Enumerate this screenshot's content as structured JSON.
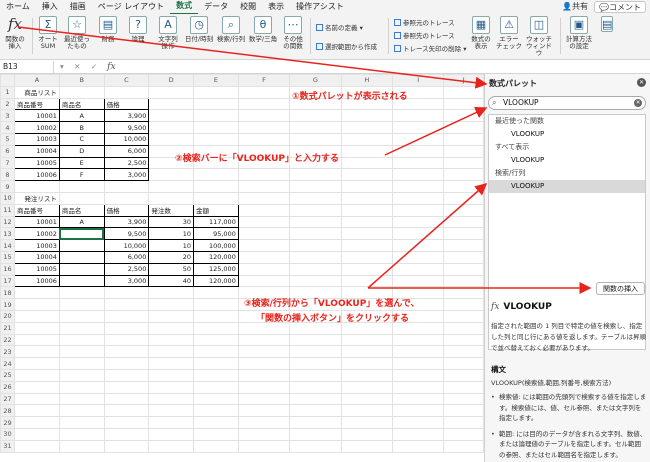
{
  "ribbon_tabs": [
    "ホーム",
    "挿入",
    "描画",
    "ページ レイアウト",
    "数式",
    "データ",
    "校閲",
    "表示",
    "操作アシスト"
  ],
  "active_tab": "数式",
  "share_label": "共有",
  "comment_label": "コメント",
  "ribbon": {
    "insert_function": "関数の\n挿入",
    "autosum": "オート\nSUM",
    "recent": "最近使っ\nたもの",
    "financial": "財務",
    "logical": "論理",
    "text": "文字列\n操作",
    "datetime": "日付/時刻",
    "lookup": "検索/行列",
    "math": "数学/三角",
    "more": "その他\nの関数",
    "define_name": "名前の定義",
    "create_from_selection": "選択範囲から作成",
    "trace_precedents": "参照元のトレース",
    "trace_dependents": "参照先のトレース",
    "remove_arrows": "トレース矢印の削除",
    "show_formulas": "数式の\n表示",
    "error_check": "エラー\nチェック",
    "watch_window": "ウォッチ\nウィンドウ",
    "calc_options": "計算方法\nの設定"
  },
  "formula_bar": {
    "name_box": "B13",
    "fx": "fx"
  },
  "column_headers": [
    "",
    "A",
    "B",
    "C",
    "D",
    "E",
    "F",
    "G",
    "H",
    "I",
    "J"
  ],
  "rows": [
    [
      "1",
      "商品リスト",
      "",
      "",
      "",
      "",
      "",
      "",
      "",
      "",
      ""
    ],
    [
      "2",
      "商品番号",
      "商品名",
      "価格",
      "",
      "",
      "",
      "",
      "",
      "",
      ""
    ],
    [
      "3",
      "10001",
      "A",
      "3,900",
      "",
      "",
      "",
      "",
      "",
      "",
      ""
    ],
    [
      "4",
      "10002",
      "B",
      "9,500",
      "",
      "",
      "",
      "",
      "",
      "",
      ""
    ],
    [
      "5",
      "10003",
      "C",
      "10,000",
      "",
      "",
      "",
      "",
      "",
      "",
      ""
    ],
    [
      "6",
      "10004",
      "D",
      "6,000",
      "",
      "",
      "",
      "",
      "",
      "",
      ""
    ],
    [
      "7",
      "10005",
      "E",
      "2,500",
      "",
      "",
      "",
      "",
      "",
      "",
      ""
    ],
    [
      "8",
      "10006",
      "F",
      "3,000",
      "",
      "",
      "",
      "",
      "",
      "",
      ""
    ],
    [
      "9",
      "",
      "",
      "",
      "",
      "",
      "",
      "",
      "",
      "",
      ""
    ],
    [
      "10",
      "発注リスト",
      "",
      "",
      "",
      "",
      "",
      "",
      "",
      "",
      ""
    ],
    [
      "11",
      "商品番号",
      "商品名",
      "価格",
      "発注数",
      "金額",
      "",
      "",
      "",
      "",
      ""
    ],
    [
      "12",
      "10001",
      "A",
      "3,900",
      "30",
      "117,000",
      "",
      "",
      "",
      "",
      ""
    ],
    [
      "13",
      "10002",
      "",
      "9,500",
      "10",
      "95,000",
      "",
      "",
      "",
      "",
      ""
    ],
    [
      "14",
      "10003",
      "",
      "10,000",
      "10",
      "100,000",
      "",
      "",
      "",
      "",
      ""
    ],
    [
      "15",
      "10004",
      "",
      "6,000",
      "20",
      "120,000",
      "",
      "",
      "",
      "",
      ""
    ],
    [
      "16",
      "10005",
      "",
      "2,500",
      "50",
      "125,000",
      "",
      "",
      "",
      "",
      ""
    ],
    [
      "17",
      "10006",
      "",
      "3,000",
      "40",
      "120,000",
      "",
      "",
      "",
      "",
      ""
    ],
    [
      "18",
      "",
      "",
      "",
      "",
      "",
      "",
      "",
      "",
      "",
      ""
    ],
    [
      "19",
      "",
      "",
      "",
      "",
      "",
      "",
      "",
      "",
      "",
      ""
    ],
    [
      "20",
      "",
      "",
      "",
      "",
      "",
      "",
      "",
      "",
      "",
      ""
    ],
    [
      "21",
      "",
      "",
      "",
      "",
      "",
      "",
      "",
      "",
      "",
      ""
    ],
    [
      "22",
      "",
      "",
      "",
      "",
      "",
      "",
      "",
      "",
      "",
      ""
    ],
    [
      "23",
      "",
      "",
      "",
      "",
      "",
      "",
      "",
      "",
      "",
      ""
    ],
    [
      "24",
      "",
      "",
      "",
      "",
      "",
      "",
      "",
      "",
      "",
      ""
    ],
    [
      "25",
      "",
      "",
      "",
      "",
      "",
      "",
      "",
      "",
      "",
      ""
    ],
    [
      "26",
      "",
      "",
      "",
      "",
      "",
      "",
      "",
      "",
      "",
      ""
    ],
    [
      "27",
      "",
      "",
      "",
      "",
      "",
      "",
      "",
      "",
      "",
      ""
    ],
    [
      "28",
      "",
      "",
      "",
      "",
      "",
      "",
      "",
      "",
      "",
      ""
    ],
    [
      "29",
      "",
      "",
      "",
      "",
      "",
      "",
      "",
      "",
      "",
      ""
    ],
    [
      "30",
      "",
      "",
      "",
      "",
      "",
      "",
      "",
      "",
      "",
      ""
    ],
    [
      "31",
      "",
      "",
      "",
      "",
      "",
      "",
      "",
      "",
      "",
      ""
    ]
  ],
  "annotations": {
    "step1": "①数式パレットが表示される",
    "step2": "②検索バーに「VLOOKUP」と入力する",
    "step3_line1": "③検索/行列から「VLOOKUP」を選んで、",
    "step3_line2": "「関数の挿入ボタン」をクリックする"
  },
  "panel": {
    "title": "数式パレット",
    "search_value": "VLOOKUP",
    "list": [
      {
        "label": "最近使った関数",
        "kind": "cat"
      },
      {
        "label": "VLOOKUP",
        "kind": "fn"
      },
      {
        "label": "すべて表示",
        "kind": "cat"
      },
      {
        "label": "VLOOKUP",
        "kind": "fn"
      },
      {
        "label": "検索/行列",
        "kind": "cat"
      },
      {
        "label": "VLOOKUP",
        "kind": "fn",
        "selected": true
      }
    ],
    "insert_button": "関数の挿入",
    "fn_name": "VLOOKUP",
    "fn_desc": "指定された範囲の 1 列目で特定の値を検索し、指定した列と同じ行にある値を返します。テーブルは昇順で並べ替えておく必要があります。",
    "syntax_heading": "構文",
    "syntax": "VLOOKUP(検索値,範囲,列番号,検索方法)",
    "args": [
      "検索値: には範囲の先頭列で検索する値を指定します。検索値には、値、セル参照、または文字列を指定します。",
      "範囲: には目的のデータが含まれる文字列、数値、または論理値のテーブルを指定します。セル範囲の参照、またはセル範囲名を指定します。"
    ]
  }
}
